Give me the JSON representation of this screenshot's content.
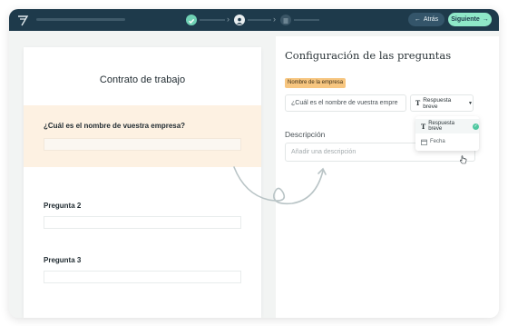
{
  "topbar": {
    "back_label": "Atrás",
    "next_label": "Siguiente",
    "icons": [
      "logo-icon",
      "check-icon",
      "user-icon",
      "list-icon",
      "arrow-left-icon",
      "arrow-right-icon"
    ]
  },
  "document": {
    "title": "Contrato de trabajo",
    "questions": [
      {
        "label": "¿Cuál es el nombre de vuestra empresa?"
      },
      {
        "label": "Pregunta 2"
      },
      {
        "label": "Pregunta 3"
      }
    ]
  },
  "settings": {
    "title": "Configuración de las preguntas",
    "tag": "Nombre de la empresa",
    "question_value": "¿Cuál es el nombre de vuestra empre",
    "type_selected": "Respuesta breve",
    "type_options": [
      "Respuesta breve",
      "Fecha"
    ],
    "description_label": "Descripción",
    "description_placeholder": "Añadir una descripción"
  },
  "colors": {
    "topbar": "#1e3a4b",
    "accent": "#8fe8c8",
    "highlight": "#fdf1e2",
    "tag": "#f7c680",
    "check": "#4fc7a0"
  }
}
